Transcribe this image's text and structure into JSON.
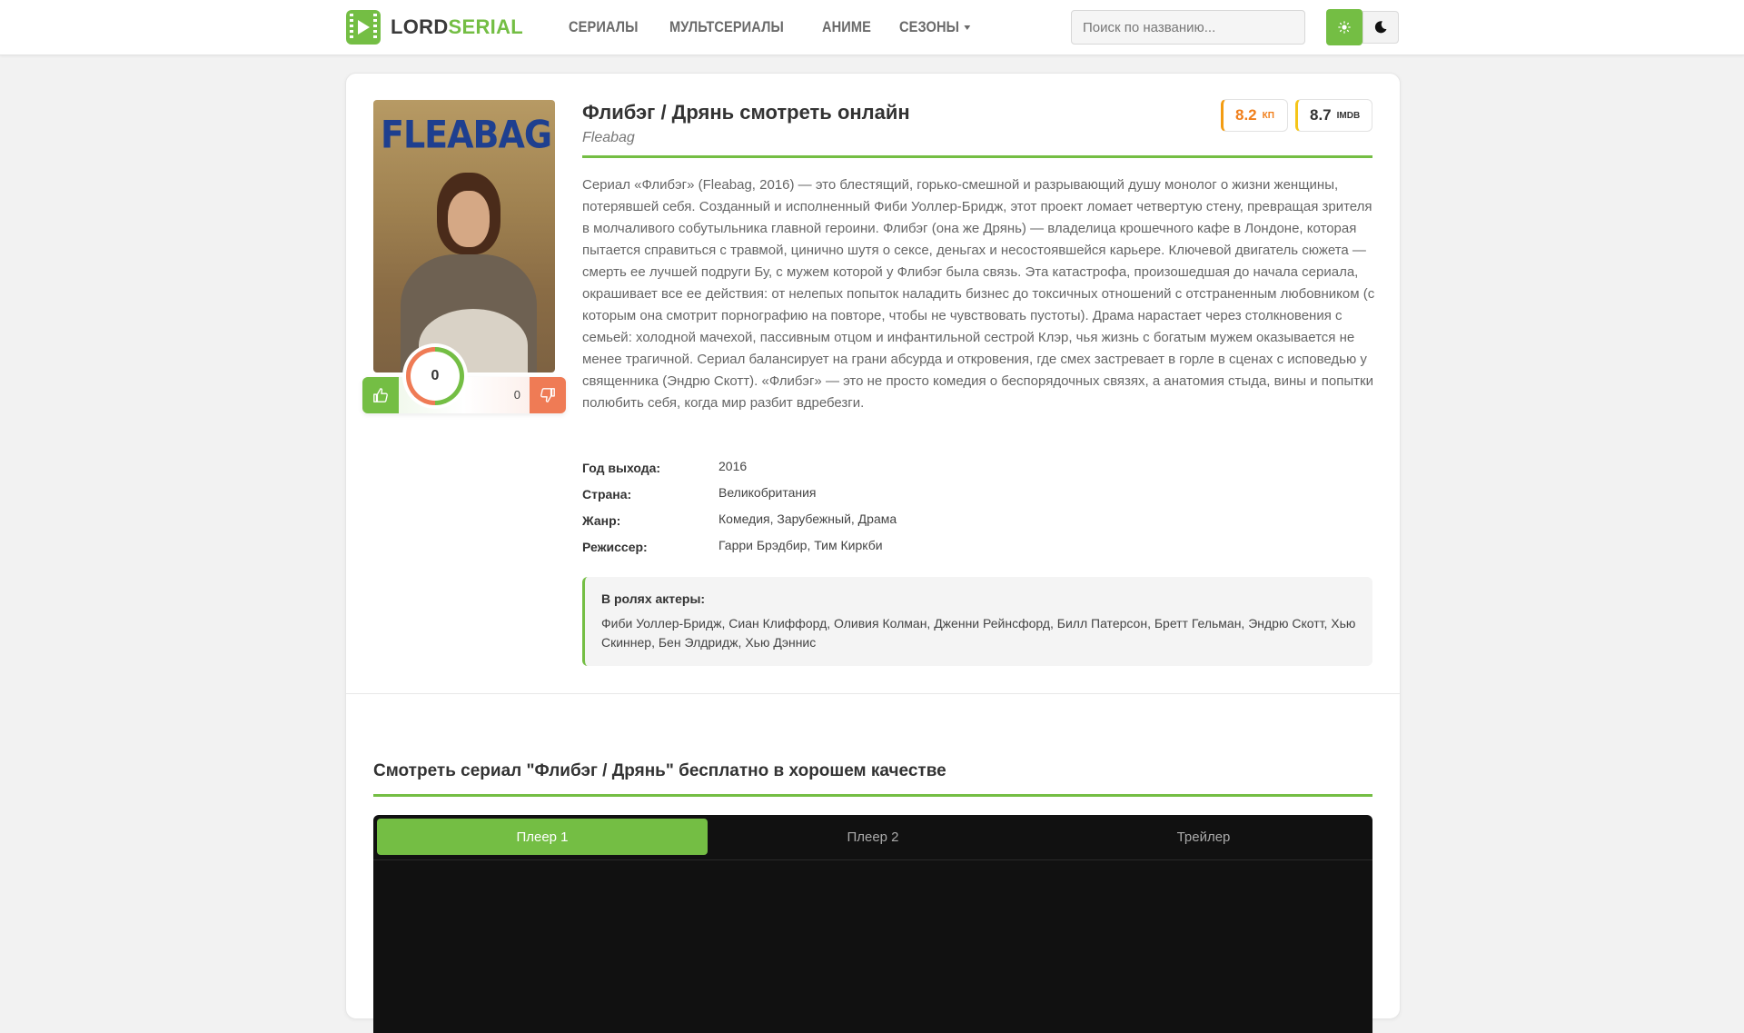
{
  "header": {
    "logo_part1": "LORD",
    "logo_part2": "SERIAL",
    "nav": [
      "СЕРИАЛЫ",
      "МУЛЬТСЕРИАЛЫ",
      "АНИМЕ",
      "СЕЗОНЫ"
    ],
    "search_placeholder": "Поиск по названию...",
    "theme_icons": [
      "sun-icon",
      "moon-icon"
    ]
  },
  "poster": {
    "text": "FLEABAG"
  },
  "rating": {
    "likes": "0",
    "dislikes": "0",
    "score": "0"
  },
  "show": {
    "title": "Флибэг / Дрянь смотреть онлайн",
    "original_title": "Fleabag",
    "kp_value": "8.2",
    "kp_label": "КП",
    "imdb_value": "8.7",
    "imdb_label": "IMDB",
    "description": "Сериал «Флибэг» (Fleabag, 2016) — это блестящий, горько-смешной и разрывающий душу монолог о жизни женщины, потерявшей себя. Созданный и исполненный Фиби Уоллер-Бридж, этот проект ломает четвертую стену, превращая зрителя в молчаливого собутыльника главной героини. Флибэг (она же Дрянь) — владелица крошечного кафе в Лондоне, которая пытается справиться с травмой, цинично шутя о сексе, деньгах и несостоявшейся карьере. Ключевой двигатель сюжета — смерть ее лучшей подруги Бу, с мужем которой у Флибэг была связь. Эта катастрофа, произошедшая до начала сериала, окрашивает все ее действия: от нелепых попыток наладить бизнес до токсичных отношений с отстраненным любовником (с которым она смотрит порнографию на повторе, чтобы не чувствовать пустоты). Драма нарастает через столкновения с семьей: холодной мачехой, пассивным отцом и инфантильной сестрой Клэр, чья жизнь с богатым мужем оказывается не менее трагичной. Сериал балансирует на грани абсурда и откровения, где смех застревает в горле в сценах с исповедью у священника (Эндрю Скотт). «Флибэг» — это не просто комедия о беспорядочных связях, а анатомия стыда, вины и попытки полюбить себя, когда мир разбит вдребезги.",
    "facts": [
      {
        "key": "Год выхода:",
        "value": "2016"
      },
      {
        "key": "Страна:",
        "value": "Великобритания"
      },
      {
        "key": "Жанр:",
        "value": "Комедия, Зарубежный, Драма"
      },
      {
        "key": "Режиссер:",
        "value": "Гарри Брэдбир, Тим Киркби"
      }
    ],
    "cast_label": "В ролях актеры:",
    "cast": "Фиби Уоллер-Бридж, Сиан Клиффорд, Оливия Колман, Дженни Рейнсфорд, Билл Патерсон, Бретт Гельман, Эндрю Скотт, Хью Скиннер, Бен Элдридж, Хью Дэннис"
  },
  "watch": {
    "title": "Смотреть сериал \"Флибэг / Дрянь\" бесплатно в хорошем качестве",
    "tabs": [
      "Плеер 1",
      "Плеер 2",
      "Трейлер"
    ],
    "active_tab": "Плеер 1"
  },
  "colors": {
    "accent": "#74be44",
    "dislike": "#ef7b55",
    "kp": "#f07e1a",
    "imdb": "#f5c518"
  }
}
